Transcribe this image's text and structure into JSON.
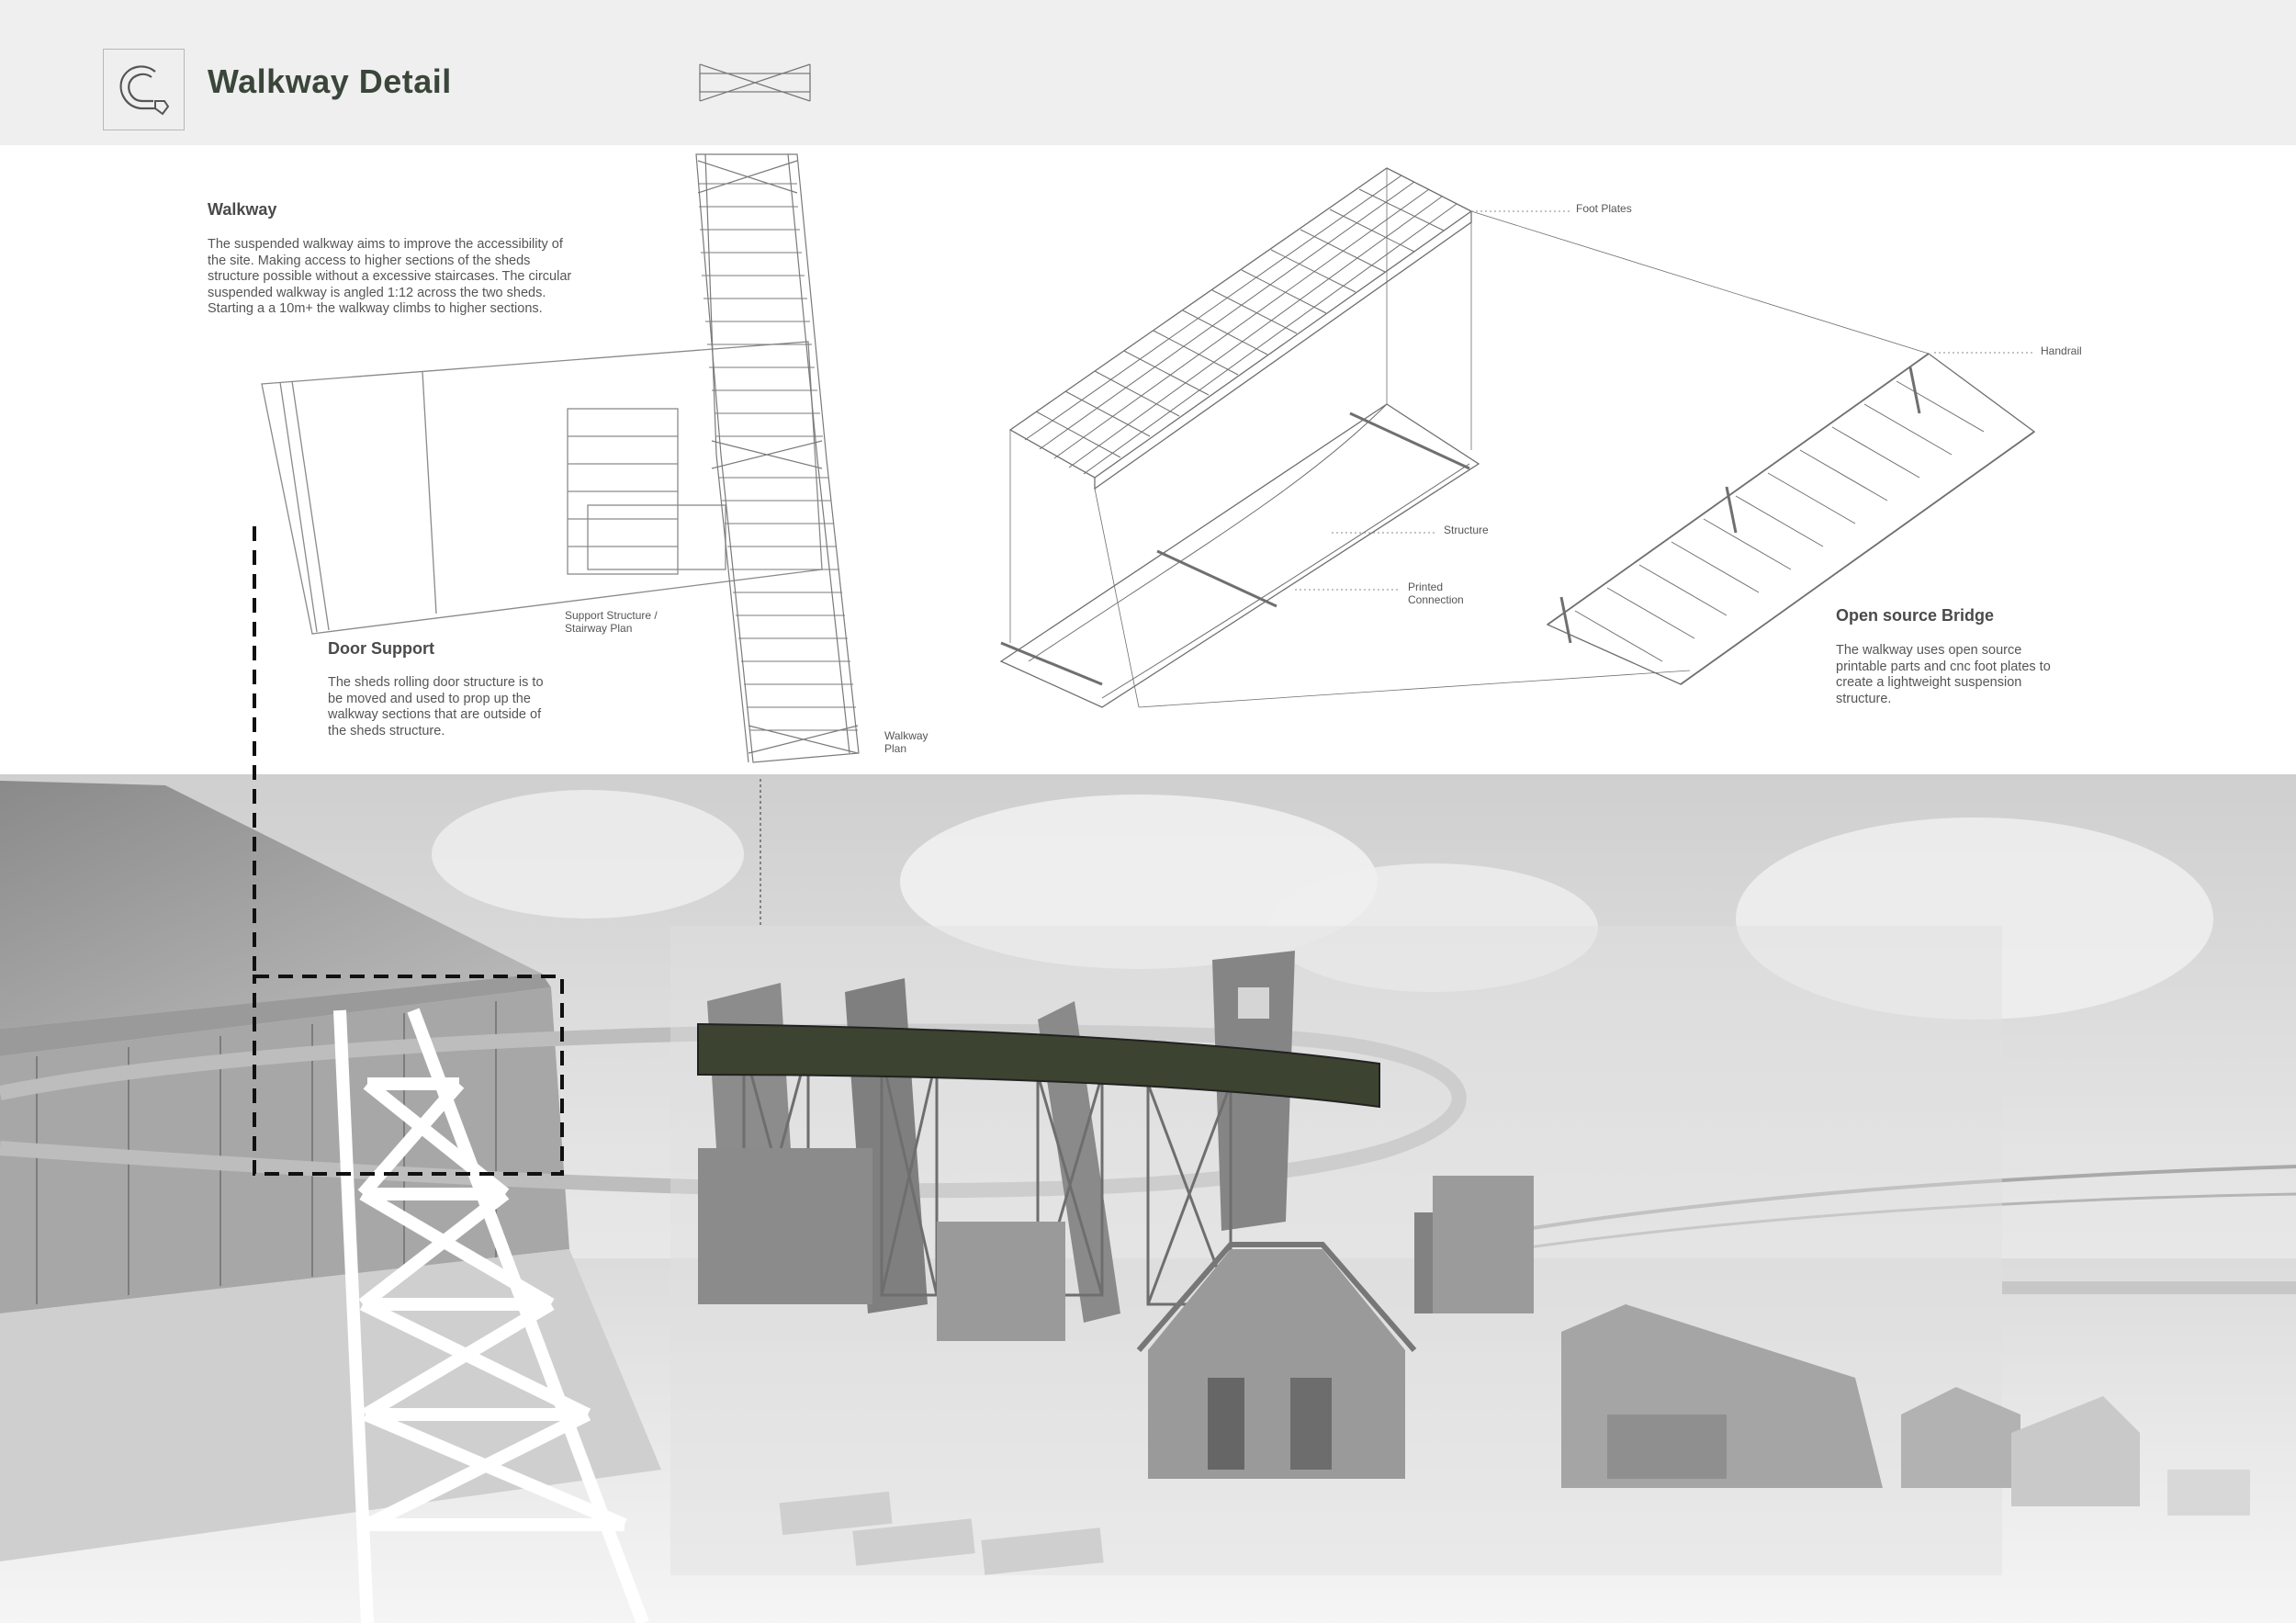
{
  "header": {
    "title": "Walkway Detail"
  },
  "walkway": {
    "heading": "Walkway",
    "body": "The suspended walkway aims to improve the accessibility of the site. Making access to higher sections of the sheds structure possible without a excessive staircases. The circular suspended walkway is angled 1:12 across the two sheds. Starting a a 10m+ the walkway climbs to higher sections."
  },
  "door_support": {
    "heading": "Door Support",
    "body": "The sheds rolling door structure is to be moved and used to prop up the walkway sections that are outside of the sheds structure."
  },
  "open_source": {
    "heading": "Open source Bridge",
    "body": "The walkway uses open source printable parts and cnc foot plates to create a lightweight suspension structure."
  },
  "labels": {
    "support_structure_1": "Support Structure /",
    "support_structure_2": "Stairway Plan",
    "walkway_plan_1": "Walkway",
    "walkway_plan_2": "Plan",
    "foot_plates": "Foot Plates",
    "handrail": "Handrail",
    "structure": "Structure",
    "printed_connection_1": "Printed",
    "printed_connection_2": "Connection"
  },
  "colors": {
    "header_bg": "#efefef",
    "title": "#3b463b",
    "walkway_highlight": "#3c4330"
  }
}
